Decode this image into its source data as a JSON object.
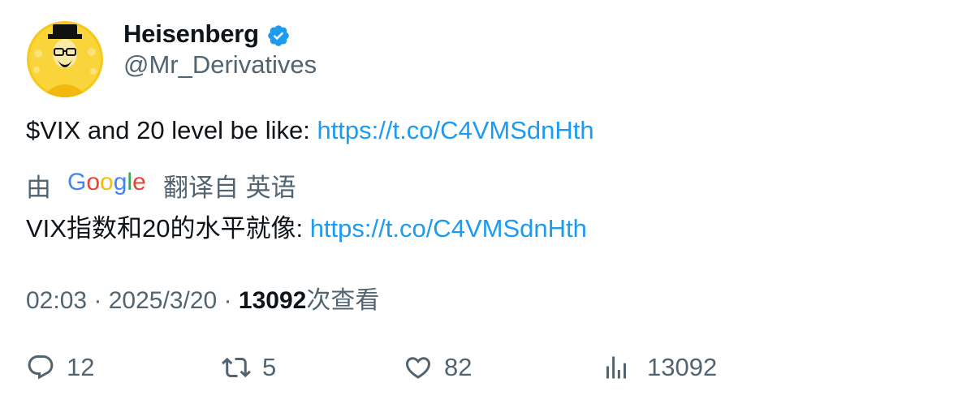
{
  "author": {
    "display_name": "Heisenberg",
    "handle": "@Mr_Derivatives",
    "verified": true
  },
  "tweet": {
    "text_prefix": "$VIX and 20 level be like: ",
    "link": "https://t.co/C4VMSdnHth"
  },
  "translation": {
    "by_label": "由",
    "provider": "Google",
    "from_label": "翻译自 英语",
    "text_prefix": "VIX指数和20的水平就像: ",
    "link": "https://t.co/C4VMSdnHth"
  },
  "meta": {
    "time": "02:03",
    "sep1": " · ",
    "date": "2025/3/20",
    "sep2": " · ",
    "views_count": "13092",
    "views_label": "次查看"
  },
  "actions": {
    "replies": "12",
    "retweets": "5",
    "likes": "82",
    "views": "13092"
  },
  "colors": {
    "link": "#1d9bf0",
    "secondary": "#536471",
    "verified": "#1d9bf0",
    "avatar_bg": "#f5c518"
  }
}
